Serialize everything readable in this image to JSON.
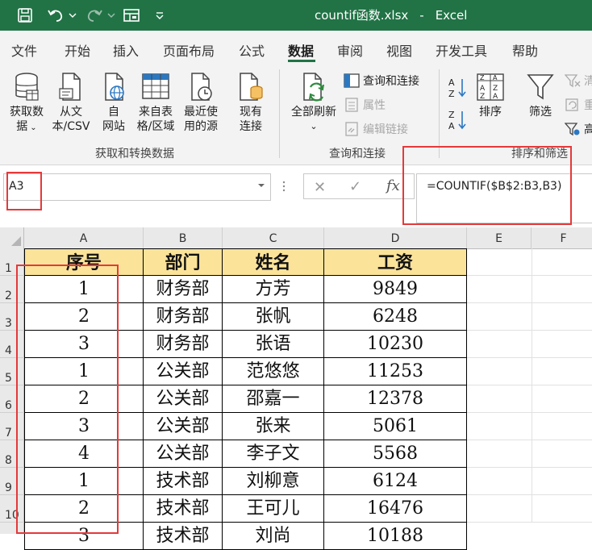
{
  "title_bar": {
    "filename": "countif函数.xlsx",
    "separator": "-",
    "app": "Excel",
    "icons": [
      "save-icon",
      "undo-icon",
      "redo-icon",
      "form-icon",
      "customize-qat-icon"
    ]
  },
  "tabs": [
    "文件",
    "开始",
    "插入",
    "页面布局",
    "公式",
    "数据",
    "审阅",
    "视图",
    "开发工具",
    "帮助"
  ],
  "active_tab": "数据",
  "ribbon": {
    "get_data": {
      "line1": "获取数",
      "line2": "据"
    },
    "from_text": {
      "line1": "从文",
      "line2": "本/CSV"
    },
    "from_web": {
      "line1": "自",
      "line2": "网站"
    },
    "from_table": {
      "line1": "来自表",
      "line2": "格/区域"
    },
    "recent_sources": {
      "line1": "最近使",
      "line2": "用的源"
    },
    "existing_conn": {
      "line1": "现有",
      "line2": "连接"
    },
    "group1_label": "获取和转换数据",
    "refresh_all": {
      "line1": "全部刷新"
    },
    "queries_conn": "查询和连接",
    "properties": "属性",
    "edit_links": "编辑链接",
    "group2_label": "查询和连接",
    "sort": "排序",
    "filter": "筛选",
    "clear_partial": "清",
    "reapply_partial": "重",
    "advanced_partial": "高",
    "group3_label": "排序和筛选"
  },
  "formula_bar": {
    "name_box": "A3",
    "formula": "=COUNTIF($B$2:B3,B3)"
  },
  "columns": [
    "A",
    "B",
    "C",
    "D",
    "E",
    "F"
  ],
  "rows": [
    "1",
    "2",
    "3",
    "4",
    "5",
    "6",
    "7",
    "8",
    "9",
    "10"
  ],
  "table": {
    "headers": [
      "序号",
      "部门",
      "姓名",
      "工资"
    ],
    "rows": [
      [
        "1",
        "财务部",
        "方芳",
        "9849"
      ],
      [
        "2",
        "财务部",
        "张帆",
        "6248"
      ],
      [
        "3",
        "财务部",
        "张语",
        "10230"
      ],
      [
        "1",
        "公关部",
        "范悠悠",
        "11253"
      ],
      [
        "2",
        "公关部",
        "邵嘉一",
        "12378"
      ],
      [
        "3",
        "公关部",
        "张来",
        "5061"
      ],
      [
        "4",
        "公关部",
        "李子文",
        "5568"
      ],
      [
        "1",
        "技术部",
        "刘柳意",
        "6124"
      ],
      [
        "2",
        "技术部",
        "王可儿",
        "16476"
      ],
      [
        "3",
        "技术部",
        "刘尚",
        "10188"
      ]
    ]
  },
  "colors": {
    "title_bar": "#217346",
    "header_fill": "#fbe39a",
    "highlight": "#e5393a"
  }
}
